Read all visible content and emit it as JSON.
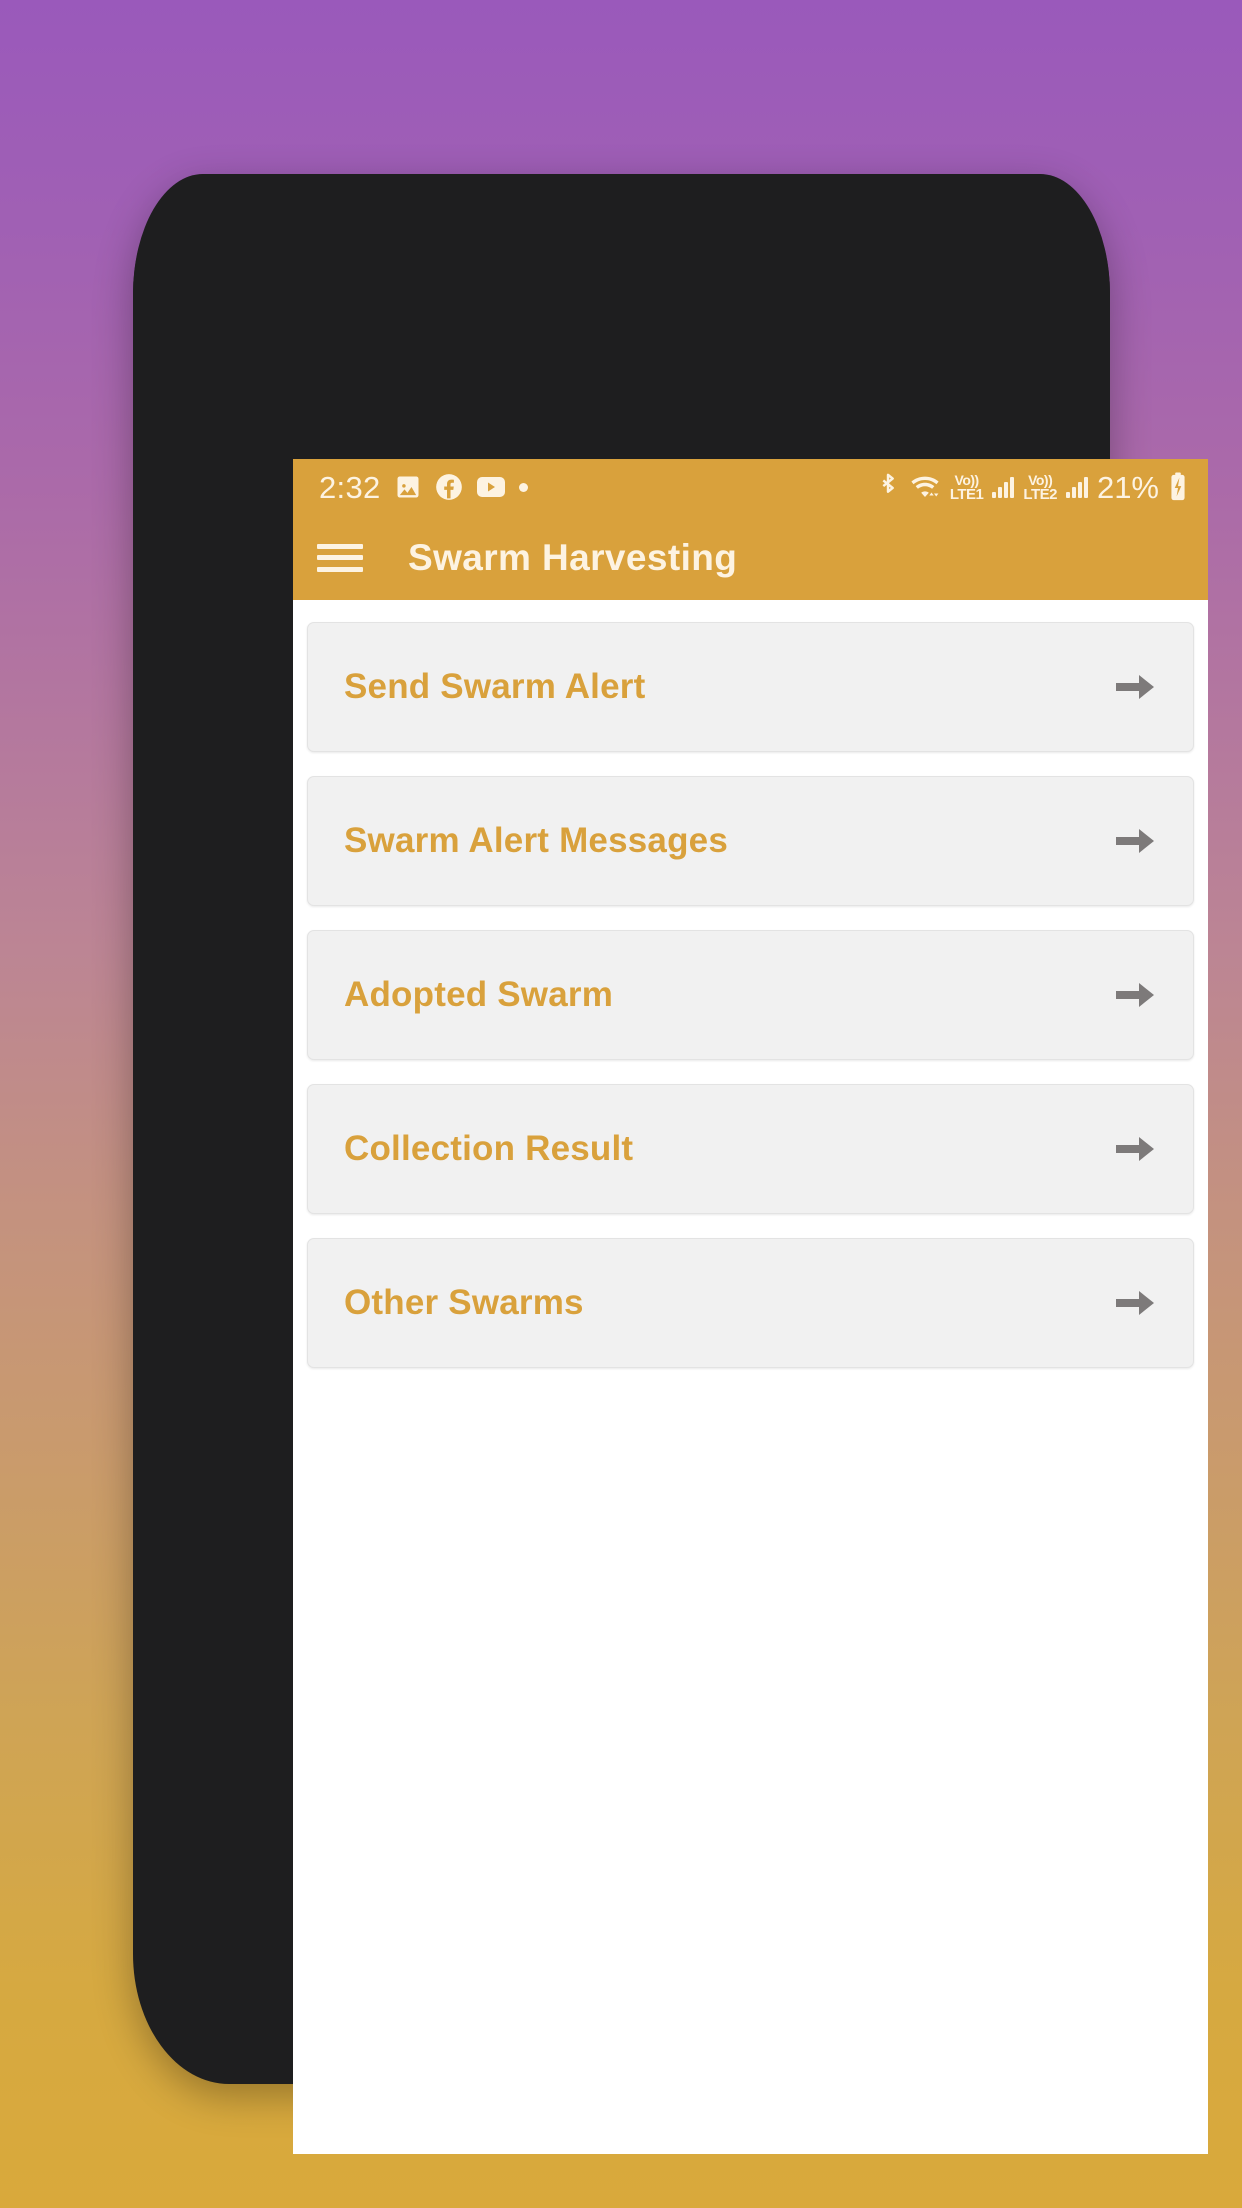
{
  "background": {
    "gradient_top": "#9a59bb",
    "gradient_bottom": "#d9a93b"
  },
  "device": {
    "frame_color": "#1e1e1f",
    "screen_background": "#ffffff"
  },
  "status_bar": {
    "background_color": "#d9a13c",
    "foreground_color": "#fdf3e2",
    "time": "2:32",
    "left_icons": [
      "image-icon",
      "facebook-icon",
      "youtube-icon",
      "dot-icon"
    ],
    "right_icons": [
      "bluetooth-icon",
      "wifi-icon"
    ],
    "sim1": {
      "label_top": "Vo))",
      "label_bottom": "LTE1",
      "signal_bars": 4
    },
    "sim2": {
      "label_top": "Vo))",
      "label_bottom": "LTE2",
      "signal_bars": 4
    },
    "battery_percent": "21%",
    "battery_icon": "battery-charging-icon"
  },
  "app_bar": {
    "background_color": "#d9a13c",
    "title": "Swarm Harvesting",
    "menu_icon": "hamburger-menu-icon",
    "title_color": "#fdf3e2"
  },
  "main": {
    "accent_color": "#d9a13c",
    "card_background": "#f1f1f1",
    "arrow_color": "#7d7a7a",
    "items": [
      {
        "label": "Send Swarm Alert",
        "icon": "arrow-right-icon"
      },
      {
        "label": "Swarm Alert Messages",
        "icon": "arrow-right-icon"
      },
      {
        "label": "Adopted Swarm",
        "icon": "arrow-right-icon"
      },
      {
        "label": "Collection Result",
        "icon": "arrow-right-icon"
      },
      {
        "label": "Other Swarms",
        "icon": "arrow-right-icon"
      }
    ]
  }
}
